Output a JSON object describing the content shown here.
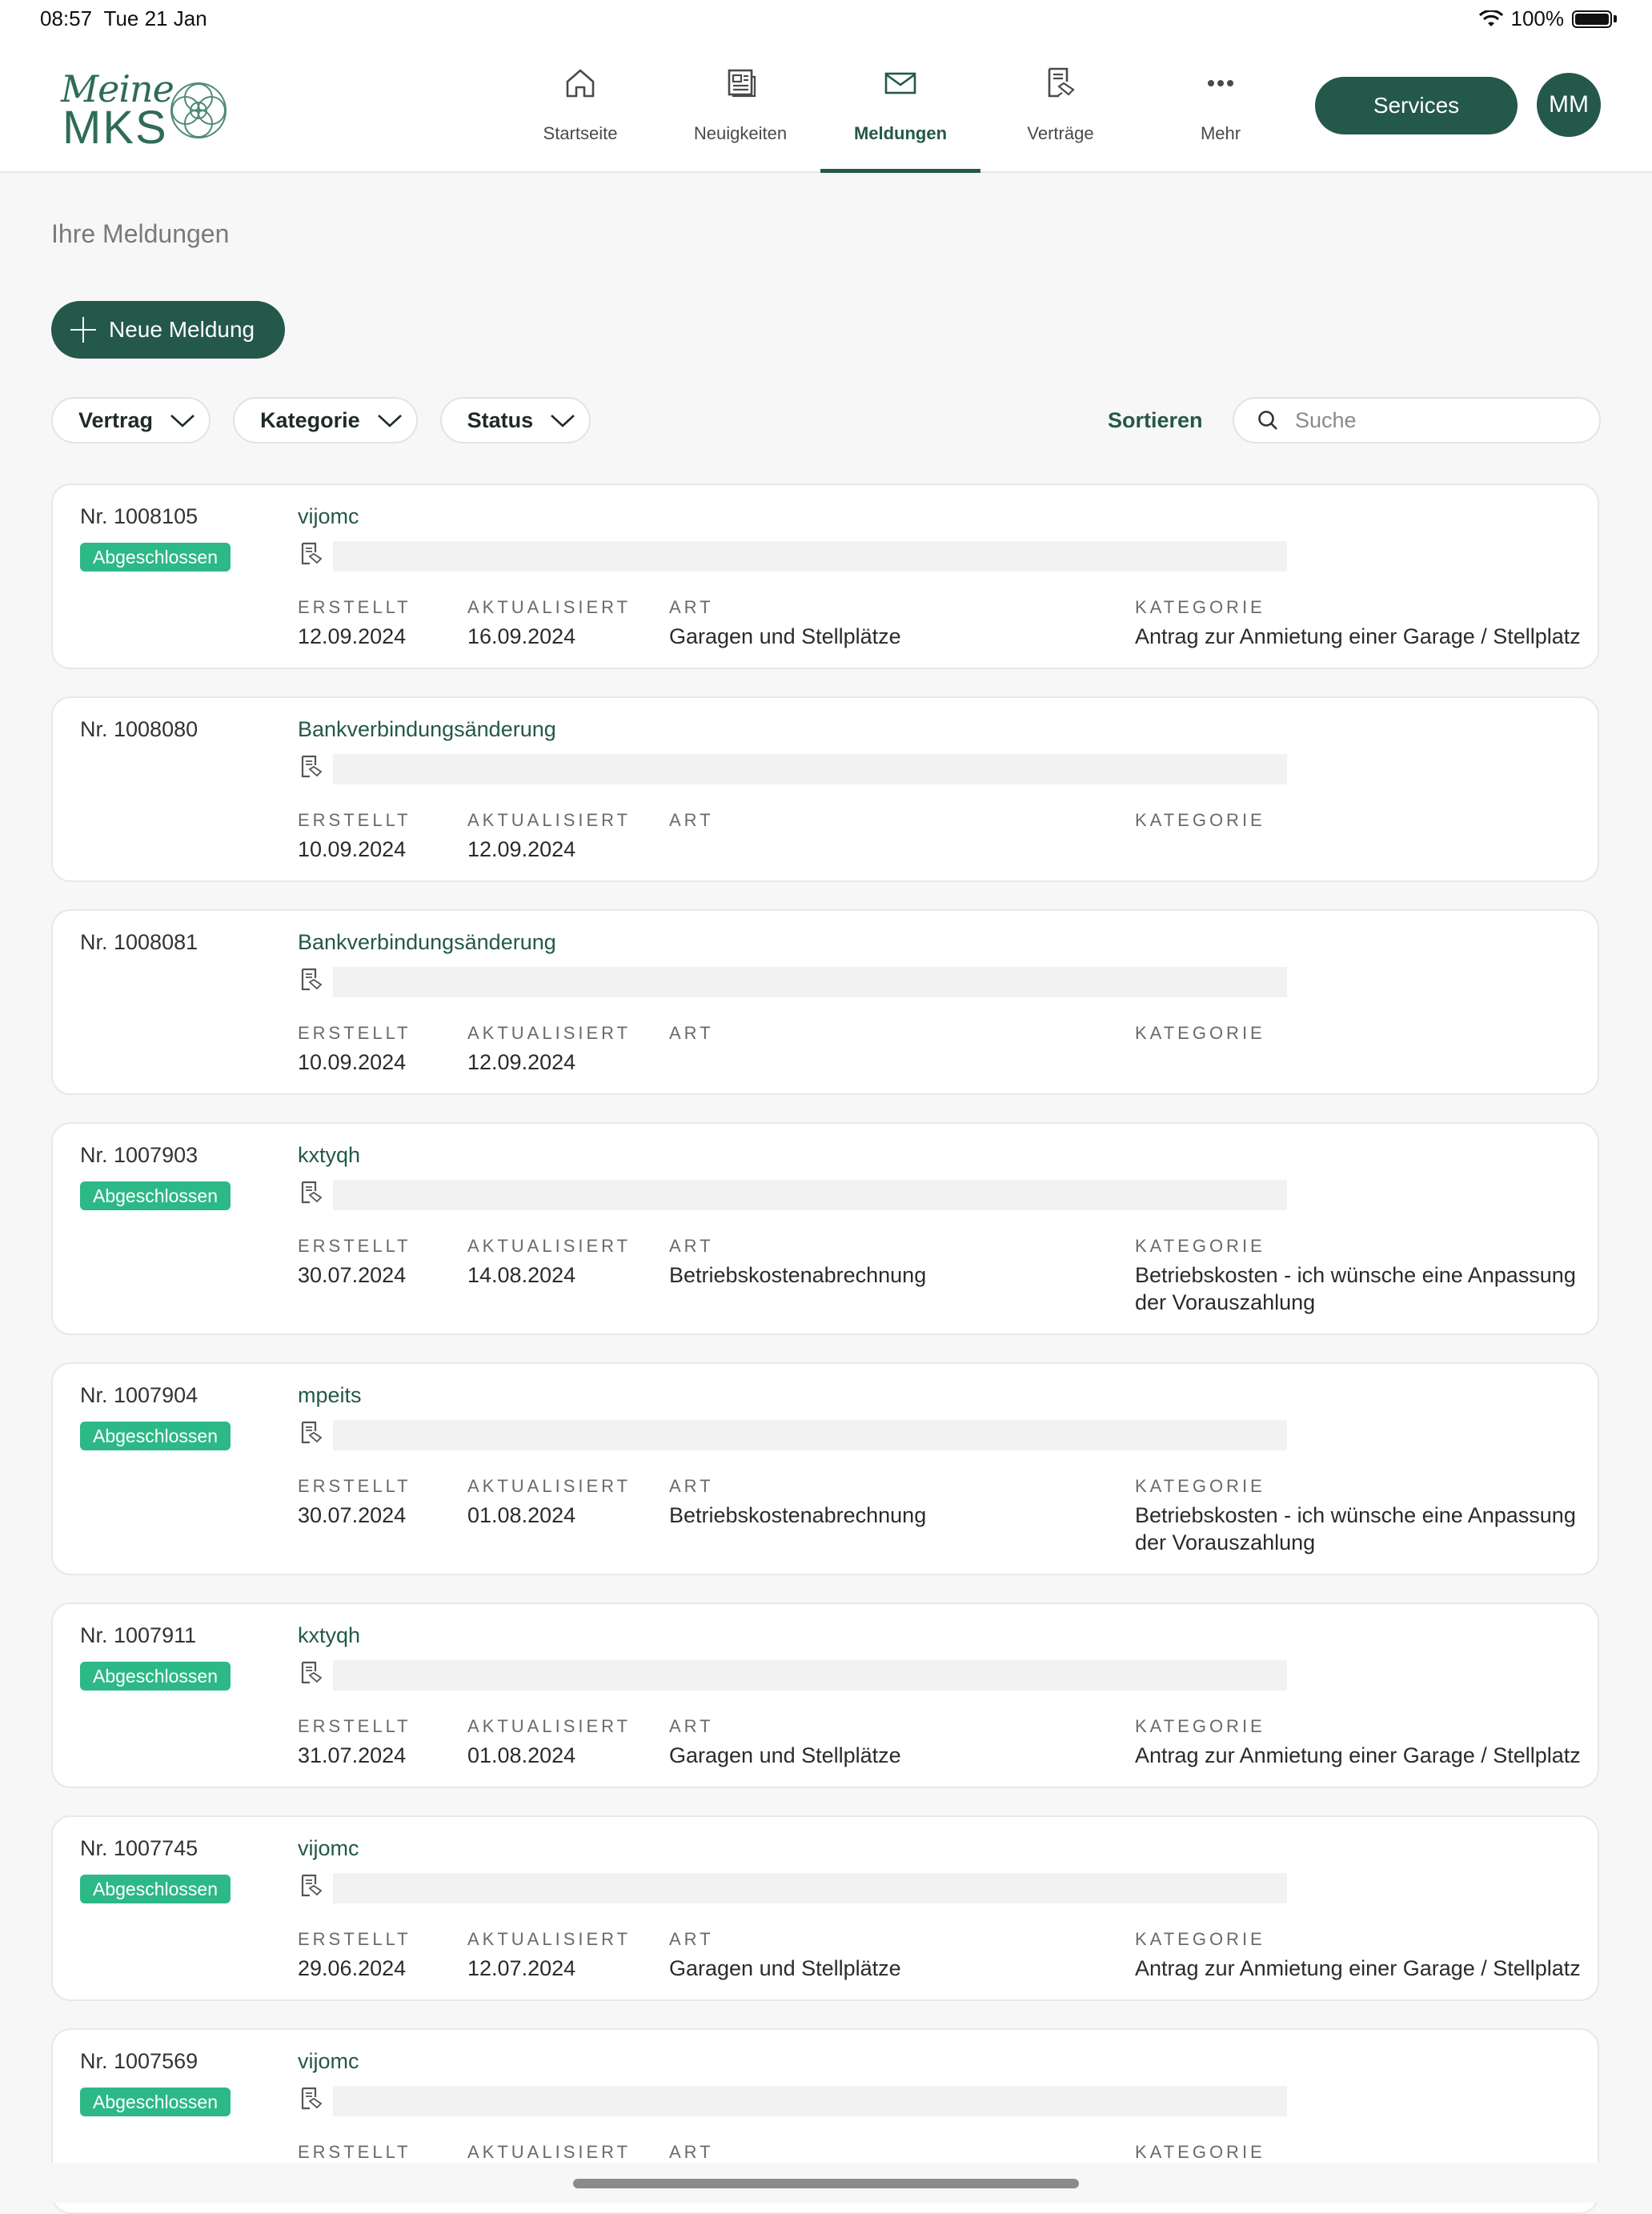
{
  "status_bar": {
    "time": "08:57",
    "date": "Tue 21 Jan",
    "battery": "100%"
  },
  "brand": {
    "line1": "Meine",
    "line2": "MKS"
  },
  "nav": [
    {
      "label": "Startseite",
      "icon": "home-icon"
    },
    {
      "label": "Neuigkeiten",
      "icon": "newspaper-icon"
    },
    {
      "label": "Meldungen",
      "icon": "mail-icon",
      "active": true
    },
    {
      "label": "Verträge",
      "icon": "contract-icon"
    },
    {
      "label": "Mehr",
      "icon": "more-icon"
    }
  ],
  "header": {
    "services_label": "Services",
    "avatar_initials": "MM"
  },
  "page": {
    "title": "Ihre Meldungen",
    "new_button": "Neue Meldung",
    "filters": {
      "vertrag": "Vertrag",
      "kategorie": "Kategorie",
      "status": "Status"
    },
    "sort_label": "Sortieren",
    "search_placeholder": "Suche"
  },
  "labels": {
    "created": "ERSTELLT",
    "updated": "AKTUALISIERT",
    "type": "ART",
    "category": "KATEGORIE"
  },
  "colors": {
    "brand": "#24584a",
    "badge": "#2db887",
    "background": "#f7f7f7"
  },
  "reports": [
    {
      "nr": "Nr. 1008105",
      "status": "Abgeschlossen",
      "title": "vijomc",
      "created": "12.09.2024",
      "updated": "16.09.2024",
      "type": "Garagen und Stellplätze",
      "category": "Antrag zur Anmietung einer Garage / Stellplatz"
    },
    {
      "nr": "Nr. 1008080",
      "status": "",
      "title": "Bankverbindungsänderung",
      "created": "10.09.2024",
      "updated": "12.09.2024",
      "type": "",
      "category": ""
    },
    {
      "nr": "Nr. 1008081",
      "status": "",
      "title": "Bankverbindungsänderung",
      "created": "10.09.2024",
      "updated": "12.09.2024",
      "type": "",
      "category": ""
    },
    {
      "nr": "Nr. 1007903",
      "status": "Abgeschlossen",
      "title": "kxtyqh",
      "created": "30.07.2024",
      "updated": "14.08.2024",
      "type": "Betriebskostenabrechnung",
      "category": "Betriebskosten - ich wünsche eine Anpassung der Vorauszahlung"
    },
    {
      "nr": "Nr. 1007904",
      "status": "Abgeschlossen",
      "title": "mpeits",
      "created": "30.07.2024",
      "updated": "01.08.2024",
      "type": "Betriebskostenabrechnung",
      "category": "Betriebskosten - ich wünsche eine Anpassung der Vorauszahlung"
    },
    {
      "nr": "Nr. 1007911",
      "status": "Abgeschlossen",
      "title": "kxtyqh",
      "created": "31.07.2024",
      "updated": "01.08.2024",
      "type": "Garagen und Stellplätze",
      "category": "Antrag zur Anmietung einer Garage / Stellplatz"
    },
    {
      "nr": "Nr. 1007745",
      "status": "Abgeschlossen",
      "title": "vijomc",
      "created": "29.06.2024",
      "updated": "12.07.2024",
      "type": "Garagen und Stellplätze",
      "category": "Antrag zur Anmietung einer Garage / Stellplatz"
    },
    {
      "nr": "Nr. 1007569",
      "status": "Abgeschlossen",
      "title": "vijomc",
      "created": "",
      "updated": "",
      "type": "",
      "category": ""
    }
  ]
}
